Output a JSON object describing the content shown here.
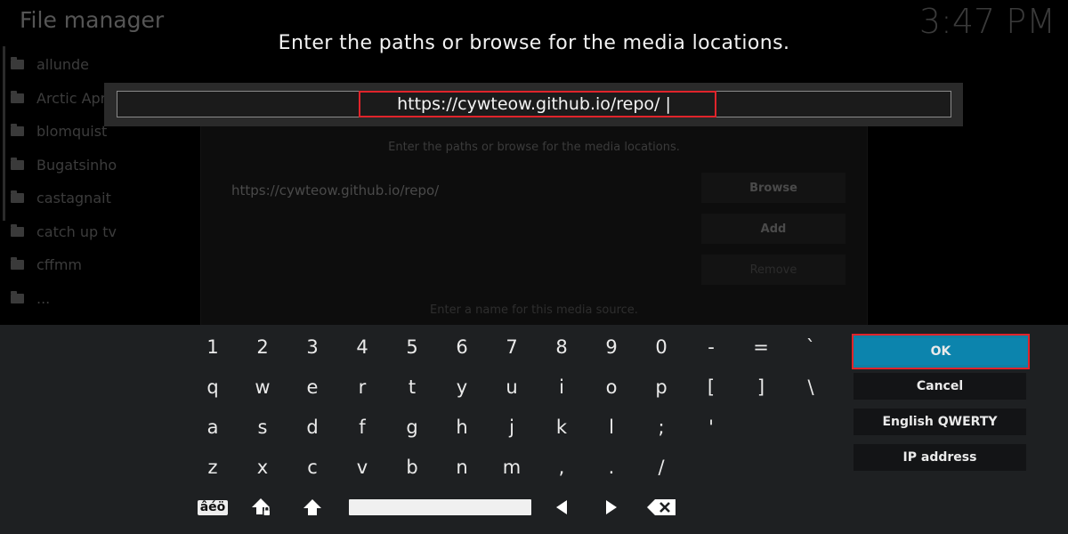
{
  "background": {
    "title": "File manager",
    "clock": "3:47 PM",
    "sources": [
      "allunde",
      "Arctic Apr",
      "blomquist",
      "Bugatsinho",
      "castagnait",
      "catch up tv",
      "cffmm",
      "..."
    ],
    "dialog": {
      "hint": "Enter the paths or browse for the media locations.",
      "url": "https://cywteow.github.io/repo/",
      "browse_label": "Browse",
      "add_label": "Add",
      "remove_label": "Remove",
      "footer": "Enter a name for this media source."
    }
  },
  "prompt": "Enter the paths or browse for the media locations.",
  "input": {
    "value": "https://cywteow.github.io/repo/ |"
  },
  "keyboard": {
    "rows": [
      [
        "1",
        "2",
        "3",
        "4",
        "5",
        "6",
        "7",
        "8",
        "9",
        "0",
        "-",
        "=",
        "`"
      ],
      [
        "q",
        "w",
        "e",
        "r",
        "t",
        "y",
        "u",
        "i",
        "o",
        "p",
        "[",
        "]",
        "\\"
      ],
      [
        "a",
        "s",
        "d",
        "f",
        "g",
        "h",
        "j",
        "k",
        "l",
        ";",
        "'"
      ],
      [
        "z",
        "x",
        "c",
        "v",
        "b",
        "n",
        "m",
        ",",
        ".",
        "/"
      ]
    ],
    "accents_label": "âéö"
  },
  "buttons": {
    "ok": "OK",
    "cancel": "Cancel",
    "layout": "English QWERTY",
    "ip": "IP address"
  },
  "colors": {
    "accent": "#0c84ad",
    "highlight": "#e0242b",
    "panel": "#1e2022"
  }
}
